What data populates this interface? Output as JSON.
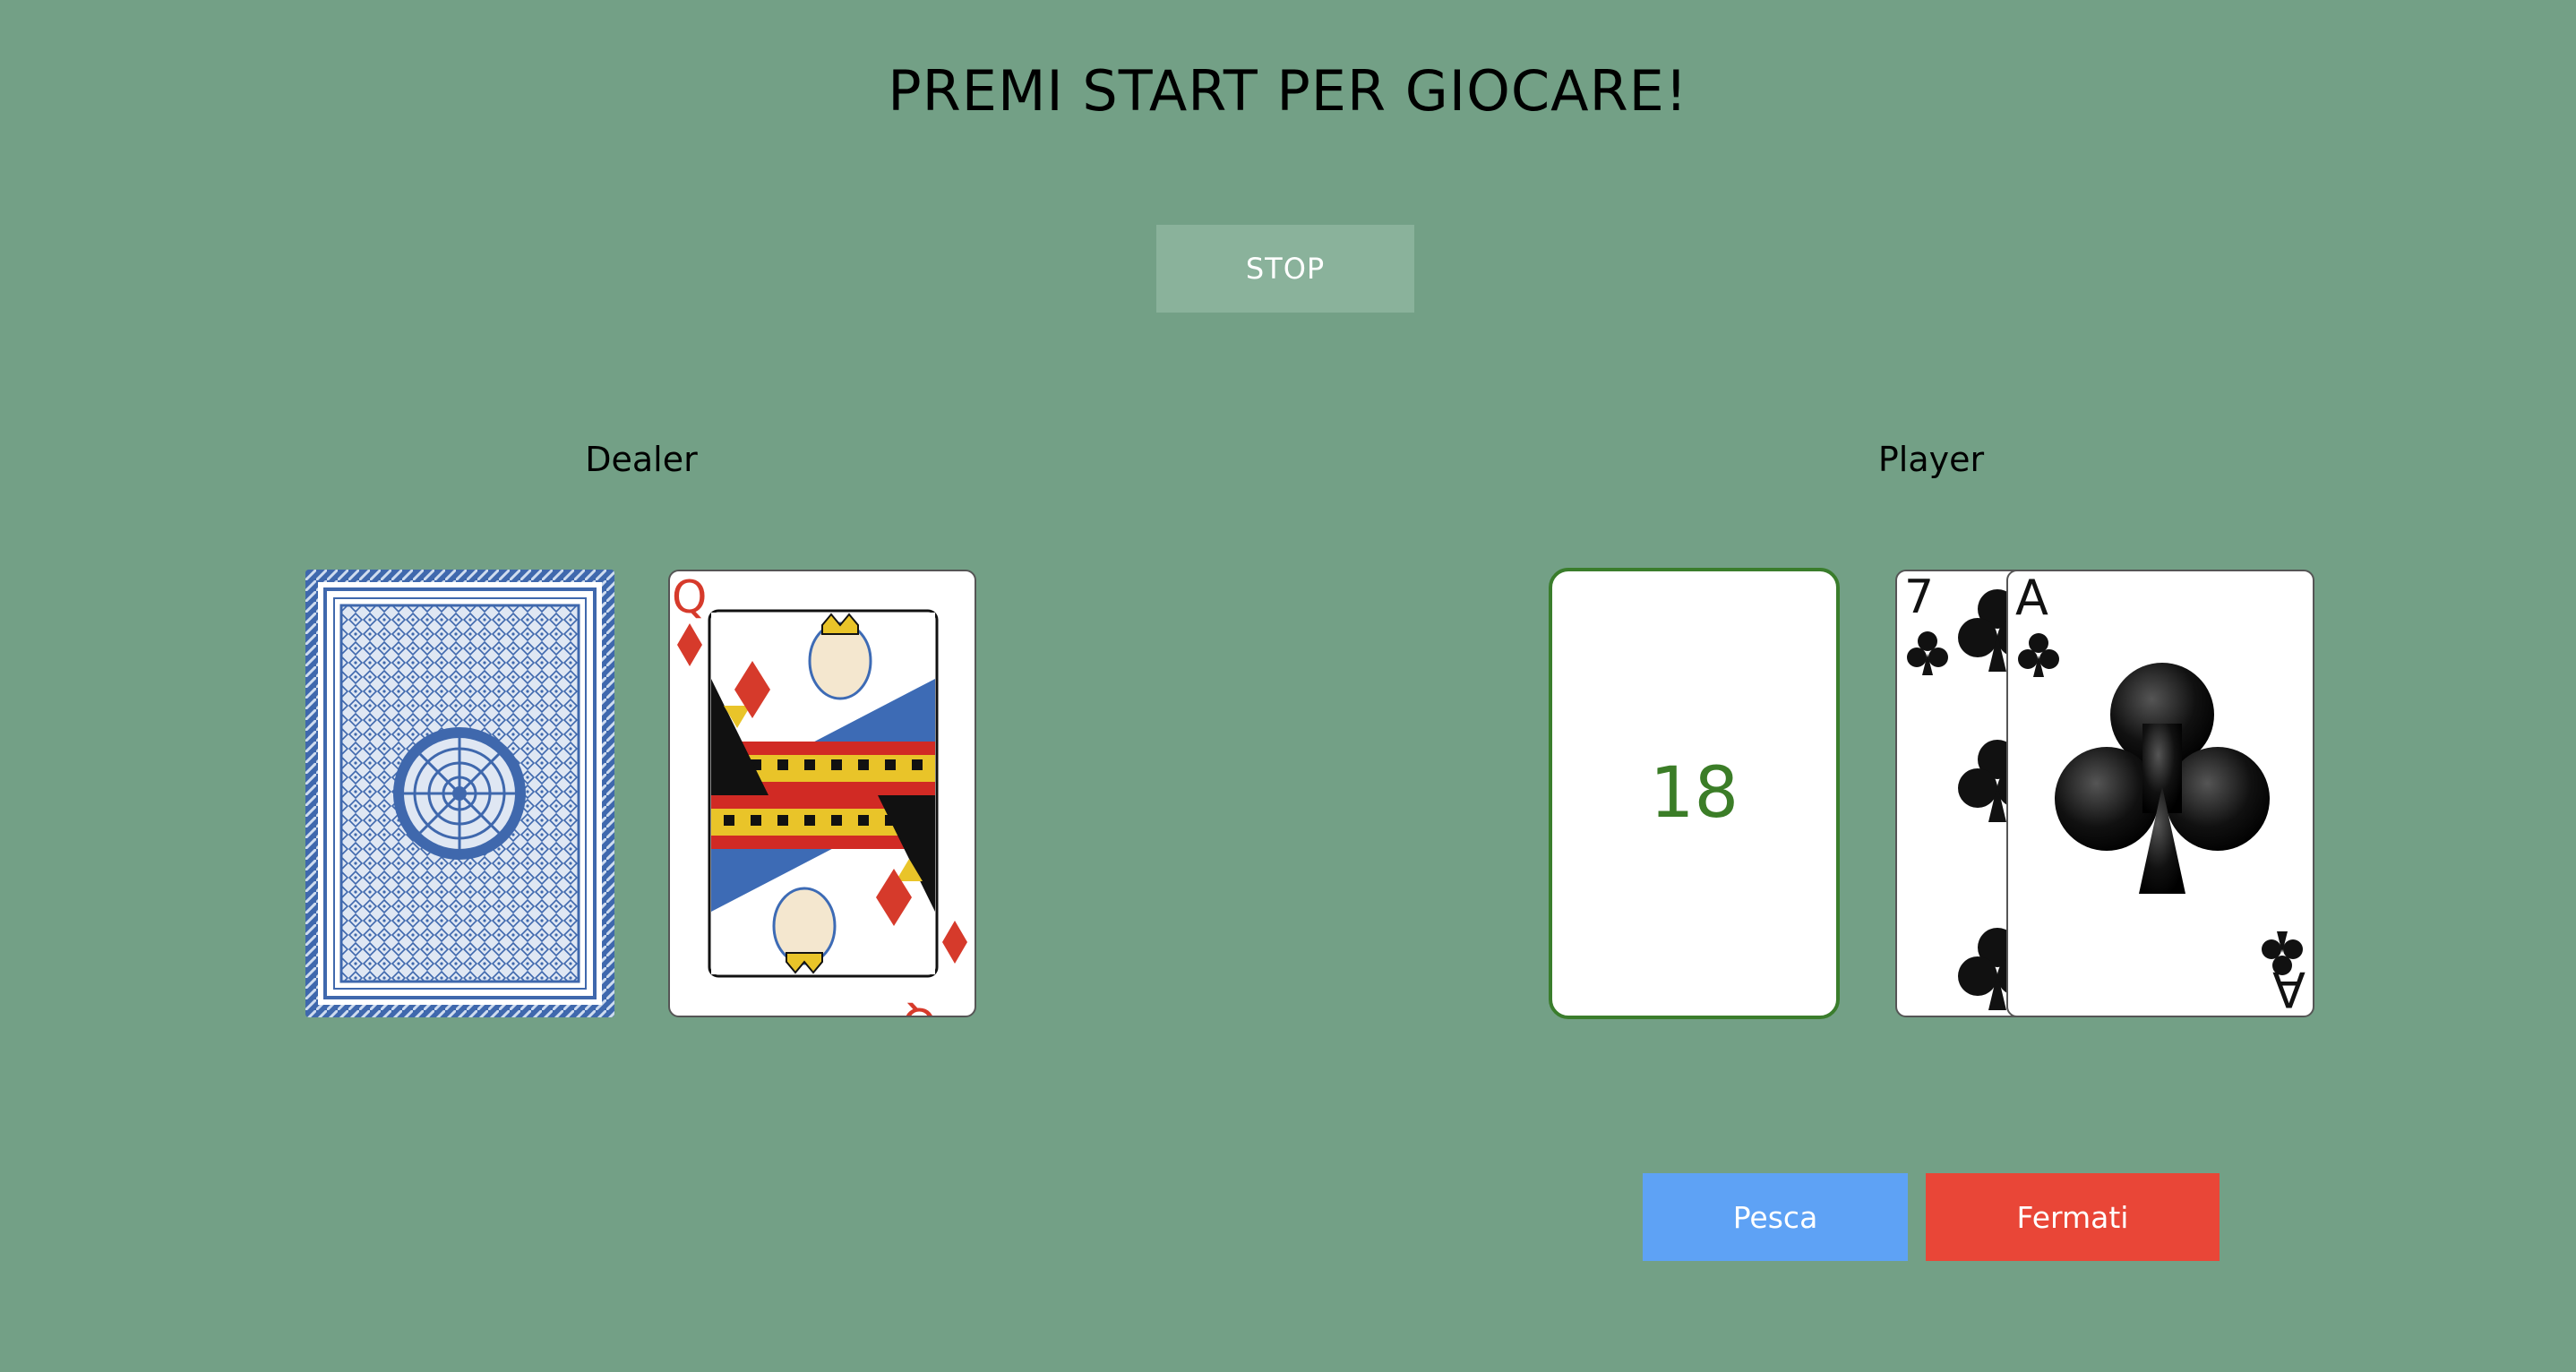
{
  "header": {
    "title": "PREMI START PER GIOCARE!"
  },
  "controls": {
    "stop_label": "STOP"
  },
  "dealer": {
    "label": "Dealer",
    "cards": [
      {
        "face": "back"
      },
      {
        "rank": "Q",
        "suit": "diamonds"
      }
    ]
  },
  "player": {
    "label": "Player",
    "score": "18",
    "cards": [
      {
        "rank": "7",
        "suit": "clubs"
      },
      {
        "rank": "A",
        "suit": "clubs"
      }
    ]
  },
  "actions": {
    "draw_label": "Pesca",
    "stand_label": "Fermati"
  },
  "colors": {
    "table": "#73a086",
    "draw_button": "#5ea2f5",
    "stand_button": "#e94637",
    "score": "#3b7d27"
  }
}
